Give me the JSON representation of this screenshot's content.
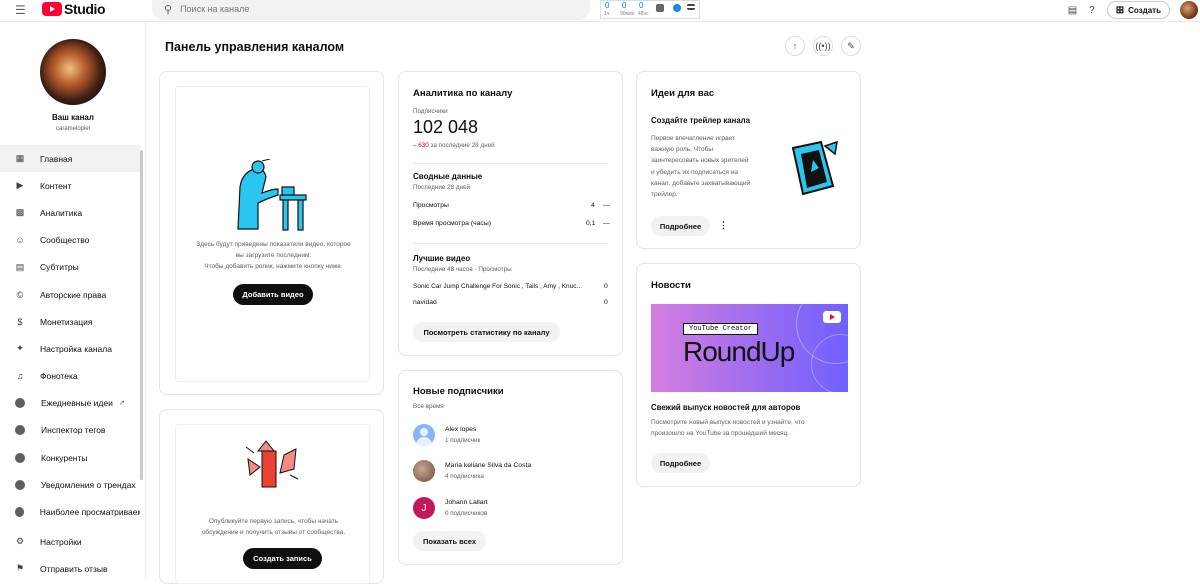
{
  "topbar": {
    "logo_text": "Studio",
    "search_placeholder": "Поиск на канале",
    "ext_counters": [
      "0",
      "0",
      "0"
    ],
    "ext_labels": [
      "1ч",
      "90мин",
      "48чс"
    ],
    "create_label": "Создать"
  },
  "sidebar": {
    "channel_name": "Ваш канал",
    "channel_handle": "caramelopiel",
    "items": [
      {
        "label": "Главная",
        "icon": "dashboard-icon"
      },
      {
        "label": "Контент",
        "icon": "content-icon"
      },
      {
        "label": "Аналитика",
        "icon": "analytics-icon"
      },
      {
        "label": "Сообщество",
        "icon": "community-icon"
      },
      {
        "label": "Субтитры",
        "icon": "subtitles-icon"
      },
      {
        "label": "Авторские права",
        "icon": "copyright-icon"
      },
      {
        "label": "Монетизация",
        "icon": "monetization-icon"
      },
      {
        "label": "Настройка канала",
        "icon": "customization-icon"
      },
      {
        "label": "Фонотека",
        "icon": "audio-library-icon"
      },
      {
        "label": "Ежедневные идеи",
        "icon": "extension-icon"
      },
      {
        "label": "Инспектор тегов",
        "icon": "extension-icon"
      },
      {
        "label": "Конкуренты",
        "icon": "extension-icon"
      },
      {
        "label": "Уведомления о трендах",
        "icon": "extension-icon"
      },
      {
        "label": "Наиболее просматриваемые",
        "icon": "extension-icon"
      }
    ],
    "bottom": [
      {
        "label": "Настройки",
        "icon": "settings-icon"
      },
      {
        "label": "Отправить отзыв",
        "icon": "feedback-icon"
      }
    ]
  },
  "main": {
    "title": "Панель управления каналом"
  },
  "upload_card": {
    "text_line1": "Здесь будут приведены показатели видео, которое",
    "text_line2": "вы загрузите последним.",
    "text_line3": "Чтобы добавить ролик, нажмите кнопку ниже.",
    "button": "Добавить видео"
  },
  "post_card": {
    "text_line1": "Опубликуйте первую запись, чтобы начать",
    "text_line2": "обсуждение и получить отзывы от сообщества.",
    "button": "Создать запись"
  },
  "analytics": {
    "title": "Аналитика по каналу",
    "subs_label": "Подписчики",
    "subs_value": "102 048",
    "subs_change": "– 630",
    "subs_period": "за последние 28 дней",
    "summary_title": "Сводные данные",
    "summary_period": "Последние 28 дней",
    "rows": [
      {
        "label": "Просмотры",
        "value": "4",
        "trend": "—"
      },
      {
        "label": "Время просмотра (часы)",
        "value": "0,1",
        "trend": "—"
      }
    ],
    "top_title": "Лучшие видео",
    "top_period": "Последние 48 часов · Просмотры",
    "top_videos": [
      {
        "title": "Sonic Car Jump Challenge For Sonic , Tails , Amy , Knuc...",
        "value": "0"
      },
      {
        "title": "navidad",
        "value": "0"
      }
    ],
    "button": "Посмотреть статистику по каналу"
  },
  "subscribers": {
    "title": "Новые подписчики",
    "period": "Все время",
    "items": [
      {
        "name": "Alex lopes",
        "count": "1 подписчик",
        "color": "#8ab4f8",
        "initial": ""
      },
      {
        "name": "Maria keliane Silva da Costa",
        "count": "4 подписчика",
        "color": "#a1887f",
        "initial": ""
      },
      {
        "name": "Johann Lallart",
        "count": "0 подписчиков",
        "color": "#c2185b",
        "initial": "J"
      }
    ],
    "button": "Показать всех"
  },
  "ideas": {
    "title": "Идеи для вас",
    "subtitle": "Создайте трейлер канала",
    "text": [
      "Первое впечатление играет",
      "важную роль. Чтобы",
      "заинтересовать новых зрителей",
      "и убедить их подписаться на",
      "канал, добавьте захватывающий",
      "трейлер."
    ],
    "button": "Подробнее"
  },
  "news": {
    "title": "Новости",
    "banner_tag": "YouTube Creator",
    "banner_title": "RoundUp",
    "headline": "Свежий выпуск новостей для авторов",
    "text_line1": "Посмотрите новый выпуск новостей и узнайте, что",
    "text_line2": "произошло на YouTube за прошедший месяц.",
    "button": "Подробнее"
  },
  "colors": {
    "accent_red": "#ff0033",
    "banner_start": "#c86dd7",
    "banner_end": "#6a5cff",
    "trend_red": "#cc0000"
  }
}
